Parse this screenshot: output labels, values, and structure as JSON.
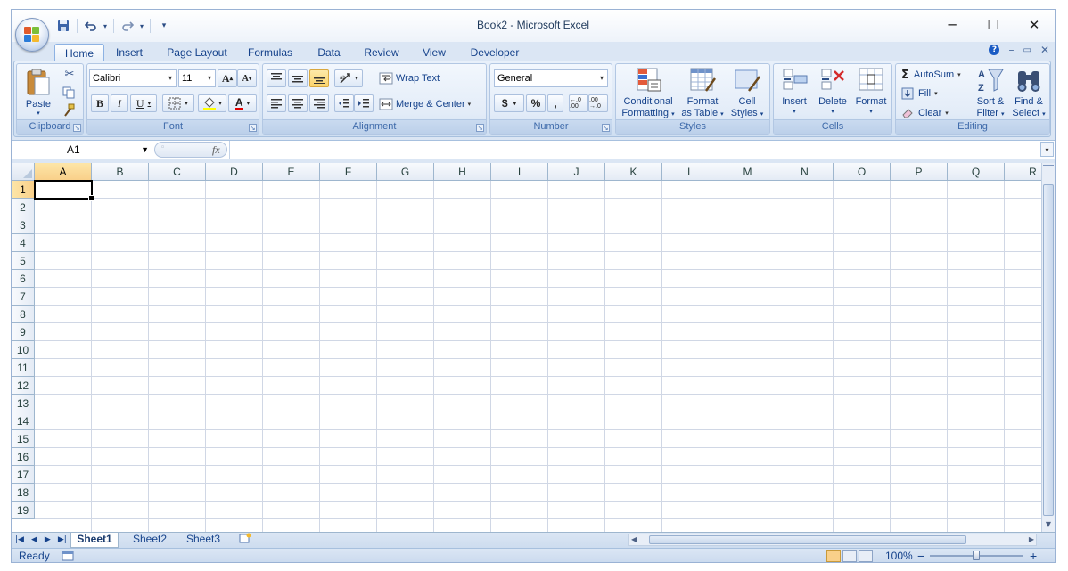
{
  "window": {
    "title": "Book2 - Microsoft Excel",
    "controls": {
      "minimize": "─",
      "maximize": "☐",
      "close": "✕"
    }
  },
  "qat": {
    "save_icon": "save-icon",
    "undo_icon": "undo-icon",
    "redo_icon": "redo-icon",
    "customize_icon": "customize-qat-icon"
  },
  "tabs": [
    {
      "label": "Home",
      "active": true
    },
    {
      "label": "Insert"
    },
    {
      "label": "Page Layout"
    },
    {
      "label": "Formulas"
    },
    {
      "label": "Data"
    },
    {
      "label": "Review"
    },
    {
      "label": "View"
    },
    {
      "label": "Developer"
    }
  ],
  "ribbon": {
    "clipboard": {
      "label": "Clipboard",
      "paste": "Paste"
    },
    "font": {
      "label": "Font",
      "name": "Calibri",
      "size": "11",
      "bold": "B",
      "italic": "I",
      "underline": "U",
      "grow": "A",
      "shrink": "A",
      "color_letter": "A"
    },
    "alignment": {
      "label": "Alignment",
      "wrap_text": "Wrap Text",
      "merge_center": "Merge & Center"
    },
    "number": {
      "label": "Number",
      "format": "General",
      "currency": "$",
      "percent": "%",
      "comma": ",",
      "inc_decimal": "←.0 .00",
      "dec_decimal": ".00 →.0"
    },
    "styles": {
      "label": "Styles",
      "conditional_1": "Conditional",
      "conditional_2": "Formatting",
      "format_table_1": "Format",
      "format_table_2": "as Table",
      "cell_styles_1": "Cell",
      "cell_styles_2": "Styles"
    },
    "cells": {
      "label": "Cells",
      "insert": "Insert",
      "delete": "Delete",
      "format": "Format"
    },
    "editing": {
      "label": "Editing",
      "autosum": "AutoSum",
      "fill": "Fill",
      "clear": "Clear",
      "sort_1": "Sort &",
      "sort_2": "Filter",
      "find_1": "Find &",
      "find_2": "Select"
    }
  },
  "formula_bar": {
    "name_box": "A1",
    "fx": "fx",
    "value": ""
  },
  "grid": {
    "columns": [
      "A",
      "B",
      "C",
      "D",
      "E",
      "F",
      "G",
      "H",
      "I",
      "J",
      "K",
      "L",
      "M",
      "N",
      "O",
      "P",
      "Q",
      "R"
    ],
    "rows": [
      "1",
      "2",
      "3",
      "4",
      "5",
      "6",
      "7",
      "8",
      "9",
      "10",
      "11",
      "12",
      "13",
      "14",
      "15",
      "16",
      "17",
      "18",
      "19"
    ],
    "active_cell": "A1"
  },
  "sheets": [
    {
      "label": "Sheet1",
      "active": true
    },
    {
      "label": "Sheet2"
    },
    {
      "label": "Sheet3"
    }
  ],
  "status": {
    "ready": "Ready",
    "zoom": "100%",
    "zoom_out": "−",
    "zoom_in": "+"
  },
  "colors": {
    "accent": "#15428b",
    "ribbon_bg": "#dbe6f4",
    "selected_header": "#f9d08a",
    "grid_line": "#d0d7e5"
  }
}
